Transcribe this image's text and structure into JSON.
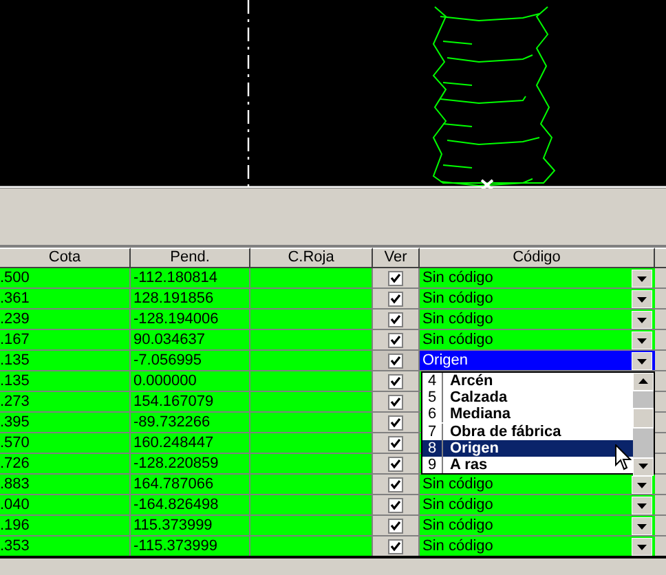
{
  "table": {
    "columns": [
      "Cota",
      "Pend.",
      "C.Roja",
      "Ver",
      "Código"
    ],
    "rows": [
      {
        "cota": ".500",
        "pend": "-112.180814",
        "ver": true,
        "codigo": "Sin código",
        "selected": false
      },
      {
        "cota": ".361",
        "pend": "128.191856",
        "ver": true,
        "codigo": "Sin código",
        "selected": false
      },
      {
        "cota": ".239",
        "pend": "-128.194006",
        "ver": true,
        "codigo": "Sin código",
        "selected": false
      },
      {
        "cota": ".167",
        "pend": "90.034637",
        "ver": true,
        "codigo": "Sin código",
        "selected": false
      },
      {
        "cota": ".135",
        "pend": "-7.056995",
        "ver": true,
        "codigo": "Origen",
        "selected": true
      },
      {
        "cota": ".135",
        "pend": "0.000000",
        "ver": true,
        "selected": false
      },
      {
        "cota": ".273",
        "pend": "154.167079",
        "ver": true,
        "selected": false
      },
      {
        "cota": ".395",
        "pend": "-89.732266",
        "ver": true,
        "selected": false
      },
      {
        "cota": ".570",
        "pend": "160.248447",
        "ver": true,
        "selected": false
      },
      {
        "cota": ".726",
        "pend": "-128.220859",
        "ver": true,
        "selected": false
      },
      {
        "cota": ".883",
        "pend": "164.787066",
        "ver": true,
        "codigo": "Sin código",
        "selected": false
      },
      {
        "cota": ".040",
        "pend": "-164.826498",
        "ver": true,
        "codigo": "Sin código",
        "selected": false
      },
      {
        "cota": ".196",
        "pend": "115.373999",
        "ver": true,
        "codigo": "Sin código",
        "selected": false
      },
      {
        "cota": ".353",
        "pend": "-115.373999",
        "ver": true,
        "codigo": "Sin código",
        "selected": false
      }
    ]
  },
  "dropdown": {
    "items": [
      {
        "number": "4",
        "label": "Arcén",
        "selected": false
      },
      {
        "number": "5",
        "label": "Calzada",
        "selected": false
      },
      {
        "number": "6",
        "label": "Mediana",
        "selected": false
      },
      {
        "number": "7",
        "label": "Obra de fábrica",
        "selected": false
      },
      {
        "number": "8",
        "label": "Origen",
        "selected": true
      },
      {
        "number": "9",
        "label": "A ras",
        "selected": false
      }
    ]
  }
}
